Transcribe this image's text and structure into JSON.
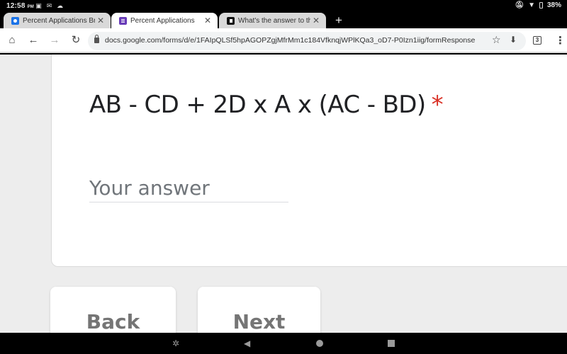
{
  "status_bar": {
    "time": "12:58",
    "ampm": "PM",
    "notification_icons": [
      "image-icon",
      "mail-icon",
      "cloud-icon"
    ],
    "battery": "38%"
  },
  "tabs": [
    {
      "title": "Percent Applications Break-C",
      "favicon": "user-form-icon",
      "favicon_color": "#1a73e8",
      "active": false
    },
    {
      "title": "Percent Applications",
      "favicon": "forms-icon",
      "favicon_color": "#673ab7",
      "active": true
    },
    {
      "title": "What's the answer to this? - E",
      "favicon": "brainly-icon",
      "favicon_color": "#111111",
      "active": false
    }
  ],
  "toolbar": {
    "url": "docs.google.com/forms/d/e/1FAIpQLSf5hpAGOPZgjMfrMm1c184VfknqjWPlKQa3_oD7-P0Izn1iig/formResponse",
    "tab_count": "3"
  },
  "form": {
    "question": "AB - CD + 2D x A x (AC - BD)",
    "required_marker": "*",
    "answer_placeholder": "Your answer",
    "answer_value": "",
    "back_label": "Back",
    "next_label": "Next"
  },
  "colors": {
    "required": "#d93025",
    "page_bg": "#ededed",
    "button_text": "#757575"
  }
}
